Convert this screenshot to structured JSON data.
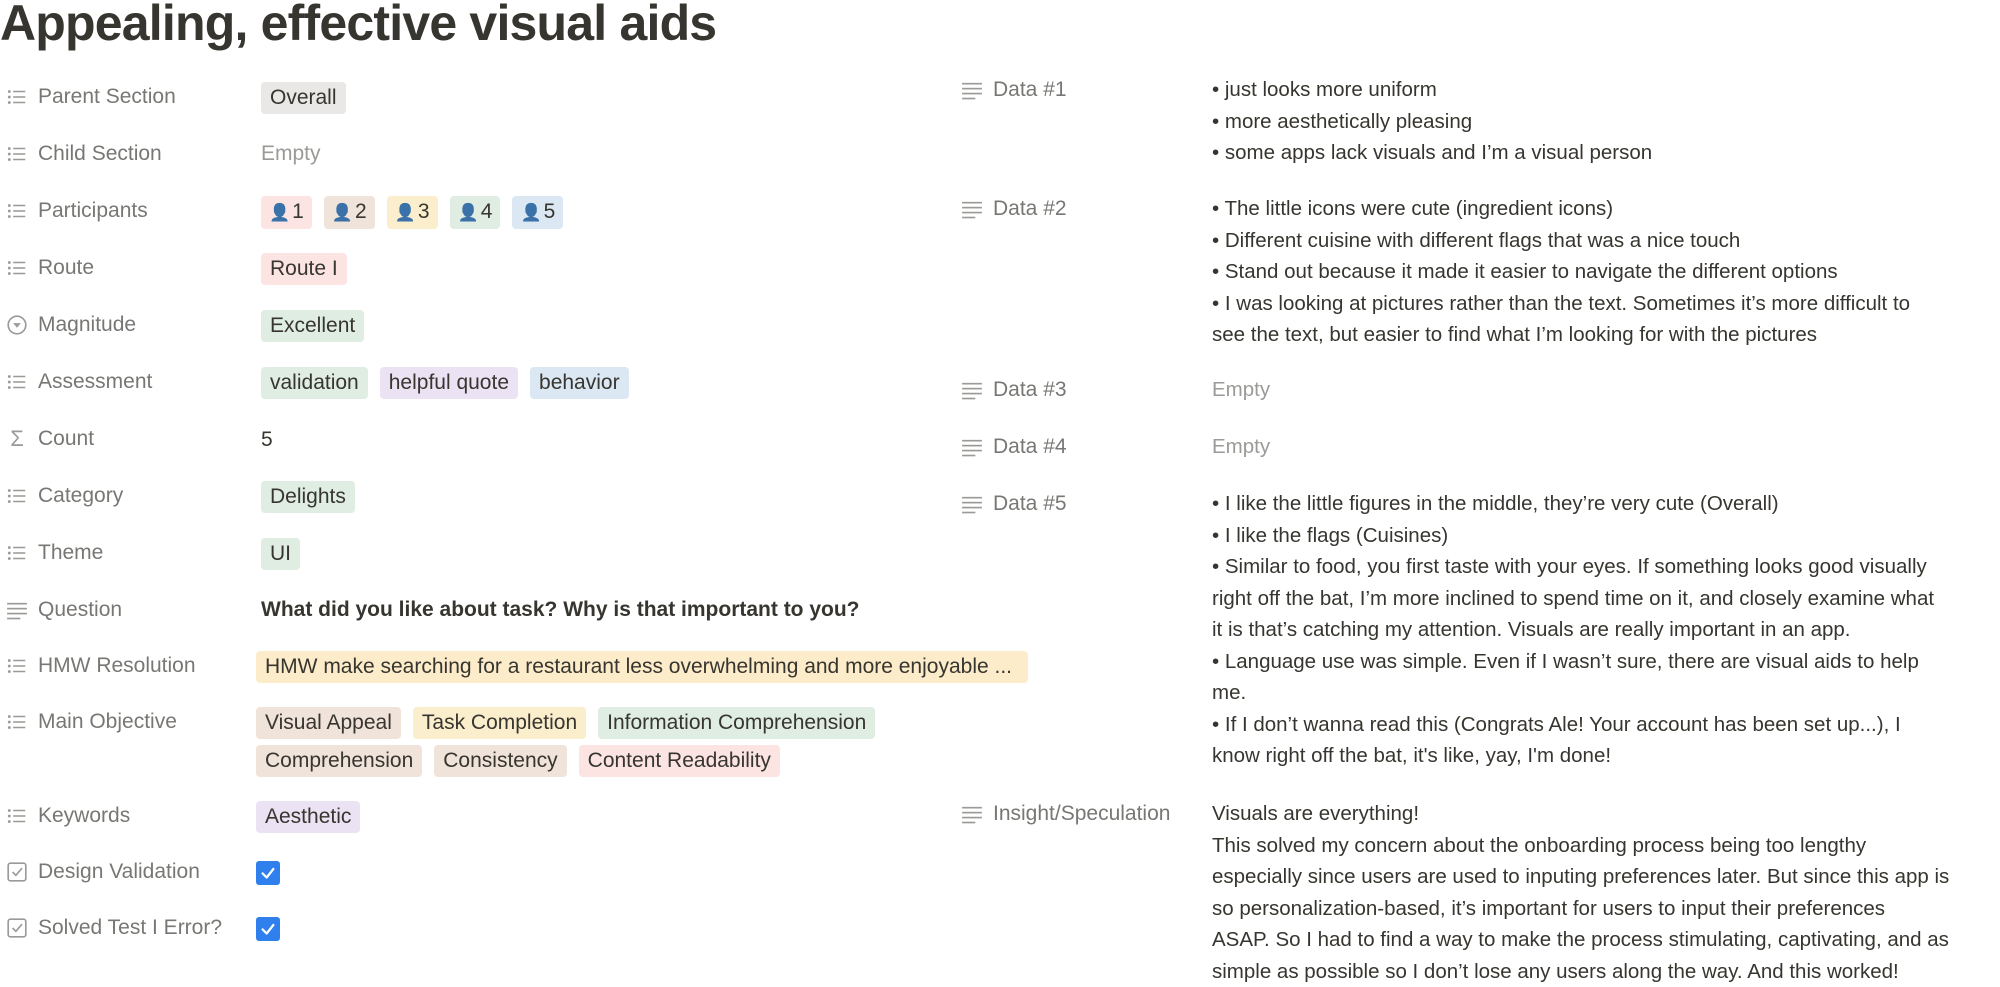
{
  "page": {
    "title": "Appealing, effective visual aids"
  },
  "left_properties": {
    "parent_section": {
      "label": "Parent Section",
      "tag": "Overall"
    },
    "child_section": {
      "label": "Child Section",
      "value": "Empty"
    },
    "participants": {
      "label": "Participants",
      "items": [
        "1",
        "2",
        "3",
        "4",
        "5"
      ]
    },
    "route": {
      "label": "Route",
      "tag": "Route I"
    },
    "magnitude": {
      "label": "Magnitude",
      "tag": "Excellent"
    },
    "assessment": {
      "label": "Assessment",
      "tags": [
        "validation",
        "helpful quote",
        "behavior"
      ]
    },
    "count": {
      "label": "Count",
      "value": "5"
    },
    "category": {
      "label": "Category",
      "tag": "Delights"
    },
    "theme": {
      "label": "Theme",
      "tag": "UI"
    },
    "question": {
      "label": "Question",
      "value": "What did you like about task? Why is that important to you?"
    },
    "hmw_resolution": {
      "label": "HMW Resolution",
      "tag": "HMW make searching for a restaurant less overwhelming and more enjoyable ..."
    },
    "main_objective": {
      "label": "Main Objective",
      "tags": [
        "Visual Appeal",
        "Task Completion",
        "Information Comprehension",
        "Comprehension",
        "Consistency",
        "Content Readability"
      ]
    },
    "keywords": {
      "label": "Keywords",
      "tag": "Aesthetic"
    },
    "design_validation": {
      "label": "Design Validation",
      "checked": true
    },
    "solved_test_error": {
      "label": "Solved Test I Error?",
      "checked": true
    }
  },
  "right_properties": {
    "data1": {
      "label": "Data #1",
      "lines": [
        "• just looks more uniform",
        "• more aesthetically pleasing",
        "• some apps lack visuals and I’m a visual person"
      ]
    },
    "data2": {
      "label": "Data #2",
      "lines": [
        "• The little icons were cute (ingredient icons)",
        "• Different cuisine with different flags that was a nice touch",
        "• Stand out because it made it easier to navigate the different options",
        "• I was looking at pictures rather than the text. Sometimes it’s more difficult to",
        "see the text, but easier to find what I’m looking for with the pictures"
      ]
    },
    "data3": {
      "label": "Data #3",
      "value": "Empty"
    },
    "data4": {
      "label": "Data #4",
      "value": "Empty"
    },
    "data5": {
      "label": "Data #5",
      "lines": [
        "• I like the little figures in the middle, they’re very cute (Overall)",
        "• I like the flags (Cuisines)",
        "• Similar to food, you first taste with your eyes. If something looks good visually",
        "right off the bat, I’m more inclined to spend time on it, and closely examine what",
        "it is that’s catching my attention. Visuals are really important in an app.",
        "• Language use was simple. Even if I wasn’t sure, there are visual aids to help",
        "me.",
        "• If I don’t wanna read this (Congrats Ale! Your account has been set up...), I",
        "know right off the bat, it's like, yay, I'm done!"
      ]
    },
    "insight": {
      "label": "Insight/Speculation",
      "lines": [
        "Visuals are everything!",
        "This solved my concern about the onboarding process being too lengthy",
        "especially since users are used to inputing preferences later. But since this app is",
        "so personalization-based, it’s important for users to input their preferences",
        "ASAP. So I had to find a way to make the process stimulating, captivating, and as",
        "simple as possible so I don’t lose any users along the way. And this worked!"
      ]
    }
  },
  "icons": {
    "list": "list-icon",
    "text": "text-lines-icon",
    "select": "select-circle-icon",
    "formula": "sigma-icon",
    "checkbox": "checkbox-icon"
  },
  "colors": {
    "gray": "#e9e8e6",
    "red": "#fbe4e2",
    "brown": "#f0e3da",
    "yellow": "#fbeecc",
    "green": "#dfede2",
    "blue": "#dbe7f2",
    "purple": "#ebe3f3",
    "hmw": "#fcecc9",
    "check": "#2f80ed"
  }
}
